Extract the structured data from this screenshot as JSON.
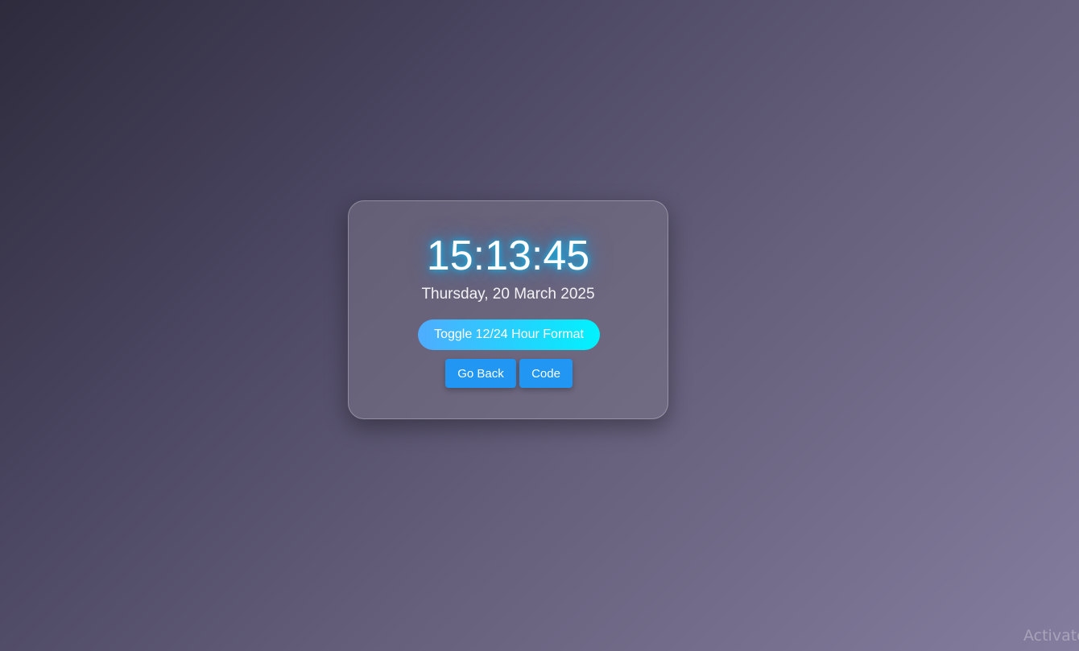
{
  "clock": {
    "time": "15:13:45",
    "date": "Thursday, 20 March 2025"
  },
  "buttons": {
    "toggle_label": "Toggle 12/24 Hour Format",
    "go_back_label": "Go Back",
    "code_label": "Code"
  },
  "watermark": {
    "text": "Activate"
  },
  "colors": {
    "button_blue": "#2196f3",
    "toggle_gradient_start": "#4facfe",
    "toggle_gradient_end": "#00f2fe",
    "glow": "#00c8ff"
  }
}
